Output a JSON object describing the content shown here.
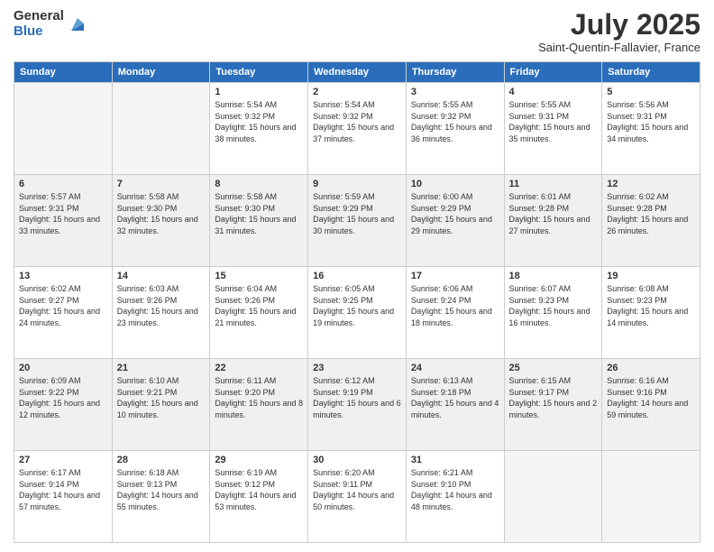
{
  "logo": {
    "general": "General",
    "blue": "Blue"
  },
  "header": {
    "month": "July 2025",
    "location": "Saint-Quentin-Fallavier, France"
  },
  "days_of_week": [
    "Sunday",
    "Monday",
    "Tuesday",
    "Wednesday",
    "Thursday",
    "Friday",
    "Saturday"
  ],
  "weeks": [
    [
      {
        "day": "",
        "info": ""
      },
      {
        "day": "",
        "info": ""
      },
      {
        "day": "1",
        "info": "Sunrise: 5:54 AM\nSunset: 9:32 PM\nDaylight: 15 hours\nand 38 minutes."
      },
      {
        "day": "2",
        "info": "Sunrise: 5:54 AM\nSunset: 9:32 PM\nDaylight: 15 hours\nand 37 minutes."
      },
      {
        "day": "3",
        "info": "Sunrise: 5:55 AM\nSunset: 9:32 PM\nDaylight: 15 hours\nand 36 minutes."
      },
      {
        "day": "4",
        "info": "Sunrise: 5:55 AM\nSunset: 9:31 PM\nDaylight: 15 hours\nand 35 minutes."
      },
      {
        "day": "5",
        "info": "Sunrise: 5:56 AM\nSunset: 9:31 PM\nDaylight: 15 hours\nand 34 minutes."
      }
    ],
    [
      {
        "day": "6",
        "info": "Sunrise: 5:57 AM\nSunset: 9:31 PM\nDaylight: 15 hours\nand 33 minutes."
      },
      {
        "day": "7",
        "info": "Sunrise: 5:58 AM\nSunset: 9:30 PM\nDaylight: 15 hours\nand 32 minutes."
      },
      {
        "day": "8",
        "info": "Sunrise: 5:58 AM\nSunset: 9:30 PM\nDaylight: 15 hours\nand 31 minutes."
      },
      {
        "day": "9",
        "info": "Sunrise: 5:59 AM\nSunset: 9:29 PM\nDaylight: 15 hours\nand 30 minutes."
      },
      {
        "day": "10",
        "info": "Sunrise: 6:00 AM\nSunset: 9:29 PM\nDaylight: 15 hours\nand 29 minutes."
      },
      {
        "day": "11",
        "info": "Sunrise: 6:01 AM\nSunset: 9:28 PM\nDaylight: 15 hours\nand 27 minutes."
      },
      {
        "day": "12",
        "info": "Sunrise: 6:02 AM\nSunset: 9:28 PM\nDaylight: 15 hours\nand 26 minutes."
      }
    ],
    [
      {
        "day": "13",
        "info": "Sunrise: 6:02 AM\nSunset: 9:27 PM\nDaylight: 15 hours\nand 24 minutes."
      },
      {
        "day": "14",
        "info": "Sunrise: 6:03 AM\nSunset: 9:26 PM\nDaylight: 15 hours\nand 23 minutes."
      },
      {
        "day": "15",
        "info": "Sunrise: 6:04 AM\nSunset: 9:26 PM\nDaylight: 15 hours\nand 21 minutes."
      },
      {
        "day": "16",
        "info": "Sunrise: 6:05 AM\nSunset: 9:25 PM\nDaylight: 15 hours\nand 19 minutes."
      },
      {
        "day": "17",
        "info": "Sunrise: 6:06 AM\nSunset: 9:24 PM\nDaylight: 15 hours\nand 18 minutes."
      },
      {
        "day": "18",
        "info": "Sunrise: 6:07 AM\nSunset: 9:23 PM\nDaylight: 15 hours\nand 16 minutes."
      },
      {
        "day": "19",
        "info": "Sunrise: 6:08 AM\nSunset: 9:23 PM\nDaylight: 15 hours\nand 14 minutes."
      }
    ],
    [
      {
        "day": "20",
        "info": "Sunrise: 6:09 AM\nSunset: 9:22 PM\nDaylight: 15 hours\nand 12 minutes."
      },
      {
        "day": "21",
        "info": "Sunrise: 6:10 AM\nSunset: 9:21 PM\nDaylight: 15 hours\nand 10 minutes."
      },
      {
        "day": "22",
        "info": "Sunrise: 6:11 AM\nSunset: 9:20 PM\nDaylight: 15 hours\nand 8 minutes."
      },
      {
        "day": "23",
        "info": "Sunrise: 6:12 AM\nSunset: 9:19 PM\nDaylight: 15 hours\nand 6 minutes."
      },
      {
        "day": "24",
        "info": "Sunrise: 6:13 AM\nSunset: 9:18 PM\nDaylight: 15 hours\nand 4 minutes."
      },
      {
        "day": "25",
        "info": "Sunrise: 6:15 AM\nSunset: 9:17 PM\nDaylight: 15 hours\nand 2 minutes."
      },
      {
        "day": "26",
        "info": "Sunrise: 6:16 AM\nSunset: 9:16 PM\nDaylight: 14 hours\nand 59 minutes."
      }
    ],
    [
      {
        "day": "27",
        "info": "Sunrise: 6:17 AM\nSunset: 9:14 PM\nDaylight: 14 hours\nand 57 minutes."
      },
      {
        "day": "28",
        "info": "Sunrise: 6:18 AM\nSunset: 9:13 PM\nDaylight: 14 hours\nand 55 minutes."
      },
      {
        "day": "29",
        "info": "Sunrise: 6:19 AM\nSunset: 9:12 PM\nDaylight: 14 hours\nand 53 minutes."
      },
      {
        "day": "30",
        "info": "Sunrise: 6:20 AM\nSunset: 9:11 PM\nDaylight: 14 hours\nand 50 minutes."
      },
      {
        "day": "31",
        "info": "Sunrise: 6:21 AM\nSunset: 9:10 PM\nDaylight: 14 hours\nand 48 minutes."
      },
      {
        "day": "",
        "info": ""
      },
      {
        "day": "",
        "info": ""
      }
    ]
  ]
}
